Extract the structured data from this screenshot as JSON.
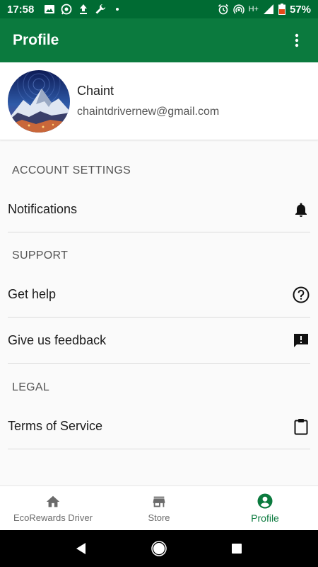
{
  "status_bar": {
    "time": "17:58",
    "network": "H+",
    "battery": "57%"
  },
  "app_bar": {
    "title": "Profile"
  },
  "profile": {
    "name": "Chaint",
    "email": "chaintdrivernew@gmail.com"
  },
  "sections": {
    "account_settings": "ACCOUNT SETTINGS",
    "support": "SUPPORT",
    "legal": "LEGAL"
  },
  "rows": {
    "notifications": "Notifications",
    "get_help": "Get help",
    "feedback": "Give us feedback",
    "terms": "Terms of Service"
  },
  "bottom_nav": [
    {
      "label": "EcoRewards Driver",
      "icon": "home-icon"
    },
    {
      "label": "Store",
      "icon": "store-icon"
    },
    {
      "label": "Profile",
      "icon": "account-circle-icon",
      "active": true
    }
  ],
  "colors": {
    "primary": "#0b7a3e",
    "primary_dark": "#006b33"
  }
}
